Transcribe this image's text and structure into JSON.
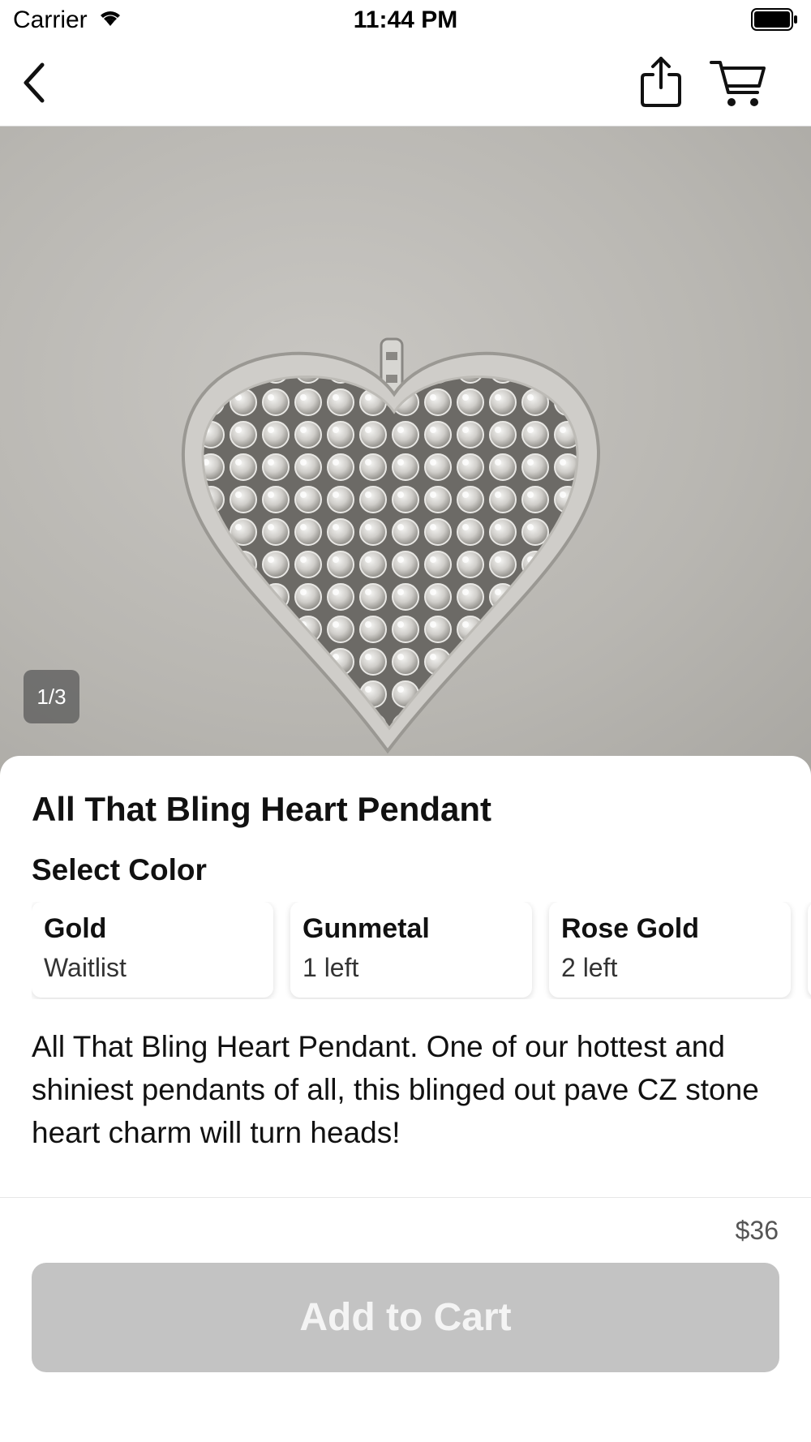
{
  "status_bar": {
    "carrier": "Carrier",
    "time": "11:44 PM"
  },
  "nav": {
    "back_icon": "chevron-left-icon",
    "share_icon": "share-icon",
    "cart_icon": "cart-icon"
  },
  "gallery": {
    "counter": "1/3",
    "current_index": 1,
    "total": 3
  },
  "product": {
    "title": "All That Bling Heart Pendant",
    "select_color_label": "Select Color",
    "colors": [
      {
        "name": "Gold",
        "stock": "Waitlist"
      },
      {
        "name": "Gunmetal",
        "stock": "1 left"
      },
      {
        "name": "Rose Gold",
        "stock": "2 left"
      }
    ],
    "description": "All That Bling Heart Pendant. One of our hottest and shiniest pendants of all, this blinged out pave CZ stone heart charm will turn heads!"
  },
  "purchase": {
    "price": "$36",
    "add_to_cart_label": "Add to Cart"
  },
  "colors": {
    "button_disabled": "#c3c3c3",
    "counter_bg": "#5a5a5a"
  }
}
